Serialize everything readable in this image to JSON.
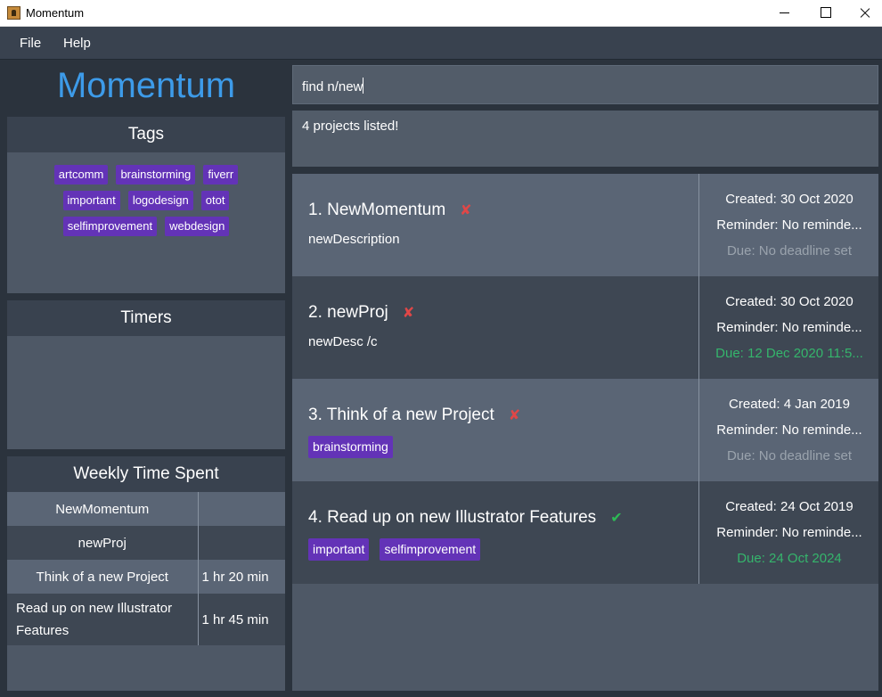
{
  "window": {
    "title": "Momentum"
  },
  "menu": {
    "file": "File",
    "help": "Help"
  },
  "brand": "Momentum",
  "tags_panel": {
    "title": "Tags",
    "tags": [
      "artcomm",
      "brainstorming",
      "fiverr",
      "important",
      "logodesign",
      "otot",
      "selfimprovement",
      "webdesign"
    ]
  },
  "timers_panel": {
    "title": "Timers"
  },
  "weekly_panel": {
    "title": "Weekly Time Spent",
    "rows": [
      {
        "name": "NewMomentum",
        "time": ""
      },
      {
        "name": "newProj",
        "time": ""
      },
      {
        "name": "Think of a new Project",
        "time": "1 hr 20 min"
      },
      {
        "name": "Read up on new Illustrator Features",
        "time": "1 hr 45 min"
      }
    ]
  },
  "command": {
    "value": "find n/new"
  },
  "result": {
    "message": "4 projects listed!"
  },
  "projects": [
    {
      "title": "1. NewMomentum",
      "status": "✘",
      "description": "newDescription",
      "tags": [],
      "created": "Created: 30 Oct 2020",
      "reminder": "Reminder: No reminde...",
      "due": "Due: No deadline set"
    },
    {
      "title": "2. newProj",
      "status": "✘",
      "description": "newDesc /c",
      "tags": [],
      "created": "Created: 30 Oct 2020",
      "reminder": "Reminder: No reminde...",
      "due": "Due: 12 Dec 2020 11:5..."
    },
    {
      "title": "3. Think of a new Project",
      "status": "✘",
      "description": "",
      "tags": [
        "brainstorming"
      ],
      "created": "Created: 4 Jan 2019",
      "reminder": "Reminder: No reminde...",
      "due": "Due: No deadline set"
    },
    {
      "title": "4. Read up on new Illustrator Features",
      "status": "✔",
      "description": "",
      "tags": [
        "important",
        "selfimprovement"
      ],
      "created": "Created: 24 Oct 2019",
      "reminder": "Reminder: No reminde...",
      "due": "Due: 24 Oct 2024"
    }
  ],
  "colors": {
    "accent": "#3d9be9",
    "tag": "#6333b7",
    "due_set": "#35b56c",
    "incomplete": "#e04747",
    "complete": "#2dbb55"
  }
}
